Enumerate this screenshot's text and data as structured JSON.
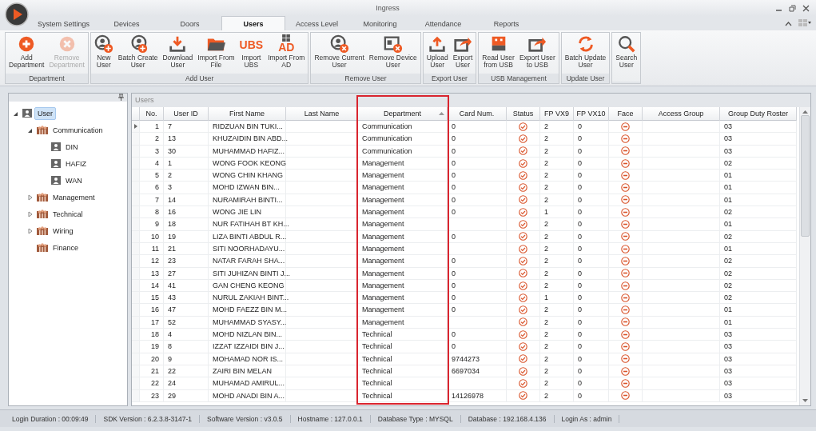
{
  "window": {
    "title": "Ingress"
  },
  "tabs": [
    {
      "label": "System Settings",
      "selected": false
    },
    {
      "label": "Devices",
      "selected": false
    },
    {
      "label": "Doors",
      "selected": false
    },
    {
      "label": "Users",
      "selected": true
    },
    {
      "label": "Access Level",
      "selected": false
    },
    {
      "label": "Monitoring",
      "selected": false
    },
    {
      "label": "Attendance",
      "selected": false
    },
    {
      "label": "Reports",
      "selected": false
    }
  ],
  "ribbon": [
    {
      "label": "Department",
      "buttons": [
        {
          "label": "Add\nDepartment",
          "kind": "add",
          "disabled": false
        },
        {
          "label": "Remove\nDepartment",
          "kind": "remove",
          "disabled": true
        }
      ]
    },
    {
      "label": "Add User",
      "buttons": [
        {
          "label": "New\nUser",
          "kind": "user-add",
          "disabled": false
        },
        {
          "label": "Batch Create\nUser",
          "kind": "users-add",
          "disabled": false
        },
        {
          "label": "Download\nUser",
          "kind": "download",
          "disabled": false
        },
        {
          "label": "Import From\nFile",
          "kind": "folder",
          "disabled": false
        },
        {
          "label": "Import\nUBS",
          "kind": "text",
          "icon_text": "UBS",
          "disabled": false
        },
        {
          "label": "Import From\nAD",
          "kind": "windows-text",
          "icon_text": "AD",
          "disabled": false
        }
      ]
    },
    {
      "label": "Remove User",
      "buttons": [
        {
          "label": "Remove Current\nUser",
          "kind": "user-remove",
          "disabled": false
        },
        {
          "label": "Remove Device\nUser",
          "kind": "device-remove",
          "disabled": false
        }
      ]
    },
    {
      "label": "Export User",
      "buttons": [
        {
          "label": "Upload\nUser",
          "kind": "upload",
          "disabled": false
        },
        {
          "label": "Export\nUser",
          "kind": "export",
          "disabled": false
        }
      ]
    },
    {
      "label": "USB Management",
      "buttons": [
        {
          "label": "Read User\nfrom USB",
          "kind": "usb",
          "disabled": false
        },
        {
          "label": "Export User\nto USB",
          "kind": "export",
          "disabled": false
        }
      ]
    },
    {
      "label": "Update User",
      "buttons": [
        {
          "label": "Batch Update\nUser",
          "kind": "refresh",
          "disabled": false
        }
      ]
    },
    {
      "buttons": [
        {
          "label": "Search\nUser",
          "kind": "search",
          "disabled": false
        }
      ]
    }
  ],
  "tree": [
    {
      "label": "User",
      "kind": "user",
      "expanded": true,
      "selected": true,
      "children": [
        {
          "label": "Communication",
          "kind": "department",
          "expanded": true,
          "selected": false,
          "children": [
            {
              "label": "DIN",
              "kind": "user",
              "selected": false
            },
            {
              "label": "HAFIZ",
              "kind": "user",
              "selected": false
            },
            {
              "label": "WAN",
              "kind": "user",
              "selected": false
            }
          ]
        },
        {
          "label": "Management",
          "kind": "department",
          "expanded": false,
          "selected": false
        },
        {
          "label": "Technical",
          "kind": "department",
          "expanded": false,
          "selected": false
        },
        {
          "label": "Wiring",
          "kind": "department",
          "expanded": false,
          "selected": false
        },
        {
          "label": "Finance",
          "kind": "department",
          "selected": false
        }
      ]
    }
  ],
  "table": {
    "title": "Users",
    "columns": [
      {
        "label": "No.",
        "kind": "text",
        "sorted": false,
        "highlighted": false
      },
      {
        "label": "User ID",
        "kind": "text",
        "sorted": false,
        "highlighted": false
      },
      {
        "label": "First Name",
        "kind": "text",
        "sorted": false,
        "highlighted": false
      },
      {
        "label": "Last Name",
        "kind": "text",
        "sorted": false,
        "highlighted": false
      },
      {
        "label": "Department",
        "kind": "text",
        "sorted": true,
        "highlighted": true
      },
      {
        "label": "Card Num.",
        "kind": "text",
        "sorted": false,
        "highlighted": false
      },
      {
        "label": "Status",
        "kind": "status",
        "sorted": false,
        "highlighted": false
      },
      {
        "label": "FP VX9",
        "kind": "text",
        "sorted": false,
        "highlighted": false
      },
      {
        "label": "FP VX10",
        "kind": "text",
        "sorted": false,
        "highlighted": false
      },
      {
        "label": "Face",
        "kind": "face",
        "sorted": false,
        "highlighted": false
      },
      {
        "label": "Access Group",
        "kind": "text",
        "sorted": false,
        "highlighted": false
      },
      {
        "label": "Group Duty Roster",
        "kind": "text",
        "sorted": false,
        "highlighted": false
      }
    ],
    "rows": [
      {
        "current": true,
        "no": "1",
        "user_id": "7",
        "first_name": "RIDZUAN BIN TUKI...",
        "department": "Communication",
        "card_num": "0",
        "status": true,
        "fp_vx9": "2",
        "fp_vx10": "0",
        "face": false,
        "roster": "03"
      },
      {
        "current": false,
        "no": "2",
        "user_id": "13",
        "first_name": "KHUZAIDIN BIN ABD...",
        "department": "Communication",
        "card_num": "0",
        "status": true,
        "fp_vx9": "2",
        "fp_vx10": "0",
        "face": false,
        "roster": "03"
      },
      {
        "current": false,
        "no": "3",
        "user_id": "30",
        "first_name": "MUHAMMAD HAFIZ...",
        "department": "Communication",
        "card_num": "0",
        "status": true,
        "fp_vx9": "2",
        "fp_vx10": "0",
        "face": false,
        "roster": "03"
      },
      {
        "current": false,
        "no": "4",
        "user_id": "1",
        "first_name": "WONG FOOK KEONG",
        "department": "Management",
        "card_num": "0",
        "status": true,
        "fp_vx9": "2",
        "fp_vx10": "0",
        "face": false,
        "roster": "02"
      },
      {
        "current": false,
        "no": "5",
        "user_id": "2",
        "first_name": "WONG CHIN KHANG",
        "department": "Management",
        "card_num": "0",
        "status": true,
        "fp_vx9": "2",
        "fp_vx10": "0",
        "face": false,
        "roster": "01"
      },
      {
        "current": false,
        "no": "6",
        "user_id": "3",
        "first_name": "MOHD IZWAN BIN...",
        "department": "Management",
        "card_num": "0",
        "status": true,
        "fp_vx9": "2",
        "fp_vx10": "0",
        "face": false,
        "roster": "01"
      },
      {
        "current": false,
        "no": "7",
        "user_id": "14",
        "first_name": "NURAMIRAH BINTI...",
        "department": "Management",
        "card_num": "0",
        "status": true,
        "fp_vx9": "2",
        "fp_vx10": "0",
        "face": false,
        "roster": "01"
      },
      {
        "current": false,
        "no": "8",
        "user_id": "16",
        "first_name": "WONG JIE LIN",
        "department": "Management",
        "card_num": "0",
        "status": true,
        "fp_vx9": "1",
        "fp_vx10": "0",
        "face": false,
        "roster": "02"
      },
      {
        "current": false,
        "no": "9",
        "user_id": "18",
        "first_name": "NUR FATIHAH BT KH...",
        "department": "Management",
        "status": true,
        "fp_vx9": "2",
        "fp_vx10": "0",
        "face": false,
        "roster": "01"
      },
      {
        "current": false,
        "no": "10",
        "user_id": "19",
        "first_name": "LIZA BINTI ABDUL R...",
        "department": "Management",
        "card_num": "0",
        "status": true,
        "fp_vx9": "2",
        "fp_vx10": "0",
        "face": false,
        "roster": "02"
      },
      {
        "current": false,
        "no": "11",
        "user_id": "21",
        "first_name": "SITI NOORHADAYU...",
        "department": "Management",
        "status": true,
        "fp_vx9": "2",
        "fp_vx10": "0",
        "face": false,
        "roster": "01"
      },
      {
        "current": false,
        "no": "12",
        "user_id": "23",
        "first_name": "NATAR FARAH SHA...",
        "department": "Management",
        "card_num": "0",
        "status": true,
        "fp_vx9": "2",
        "fp_vx10": "0",
        "face": false,
        "roster": "02"
      },
      {
        "current": false,
        "no": "13",
        "user_id": "27",
        "first_name": "SITI JUHIZAN BINTI J...",
        "department": "Management",
        "card_num": "0",
        "status": true,
        "fp_vx9": "2",
        "fp_vx10": "0",
        "face": false,
        "roster": "02"
      },
      {
        "current": false,
        "no": "14",
        "user_id": "41",
        "first_name": "GAN CHENG KEONG",
        "department": "Management",
        "card_num": "0",
        "status": true,
        "fp_vx9": "2",
        "fp_vx10": "0",
        "face": false,
        "roster": "02"
      },
      {
        "current": false,
        "no": "15",
        "user_id": "43",
        "first_name": "NURUL ZAKIAH BINT...",
        "department": "Management",
        "card_num": "0",
        "status": true,
        "fp_vx9": "1",
        "fp_vx10": "0",
        "face": false,
        "roster": "02"
      },
      {
        "current": false,
        "no": "16",
        "user_id": "47",
        "first_name": "MOHD FAEZZ BIN M...",
        "department": "Management",
        "card_num": "0",
        "status": true,
        "fp_vx9": "2",
        "fp_vx10": "0",
        "face": false,
        "roster": "01"
      },
      {
        "current": false,
        "no": "17",
        "user_id": "52",
        "first_name": "MUHAMMAD SYASY...",
        "department": "Management",
        "status": true,
        "fp_vx9": "2",
        "fp_vx10": "0",
        "face": false,
        "roster": "01"
      },
      {
        "current": false,
        "no": "18",
        "user_id": "4",
        "first_name": "MOHD NIZLAN BIN...",
        "department": "Technical",
        "card_num": "0",
        "status": true,
        "fp_vx9": "2",
        "fp_vx10": "0",
        "face": false,
        "roster": "03"
      },
      {
        "current": false,
        "no": "19",
        "user_id": "8",
        "first_name": "IZZAT IZZAIDI BIN J...",
        "department": "Technical",
        "card_num": "0",
        "status": true,
        "fp_vx9": "2",
        "fp_vx10": "0",
        "face": false,
        "roster": "03"
      },
      {
        "current": false,
        "no": "20",
        "user_id": "9",
        "first_name": "MOHAMAD NOR IS...",
        "department": "Technical",
        "card_num": "9744273",
        "status": true,
        "fp_vx9": "2",
        "fp_vx10": "0",
        "face": false,
        "roster": "03"
      },
      {
        "current": false,
        "no": "21",
        "user_id": "22",
        "first_name": "ZAIRI BIN MELAN",
        "department": "Technical",
        "card_num": "6697034",
        "status": true,
        "fp_vx9": "2",
        "fp_vx10": "0",
        "face": false,
        "roster": "03"
      },
      {
        "current": false,
        "no": "22",
        "user_id": "24",
        "first_name": "MUHAMAD AMIRUL...",
        "department": "Technical",
        "status": true,
        "fp_vx9": "2",
        "fp_vx10": "0",
        "face": false,
        "roster": "03"
      },
      {
        "current": false,
        "no": "23",
        "user_id": "29",
        "first_name": "MOHD ANADI BIN A...",
        "department": "Technical",
        "card_num": "14126978",
        "status": true,
        "fp_vx9": "2",
        "fp_vx10": "0",
        "face": false,
        "roster": "03"
      }
    ]
  },
  "status_bar": [
    "Login Duration : 00:09:49",
    "SDK Version : 6.2.3.8-3147-1",
    "Software Version : v3.0.5",
    "Hostname : 127.0.0.1",
    "Database Type : MYSQL",
    "Database : 192.168.4.136",
    "Login As : admin"
  ]
}
